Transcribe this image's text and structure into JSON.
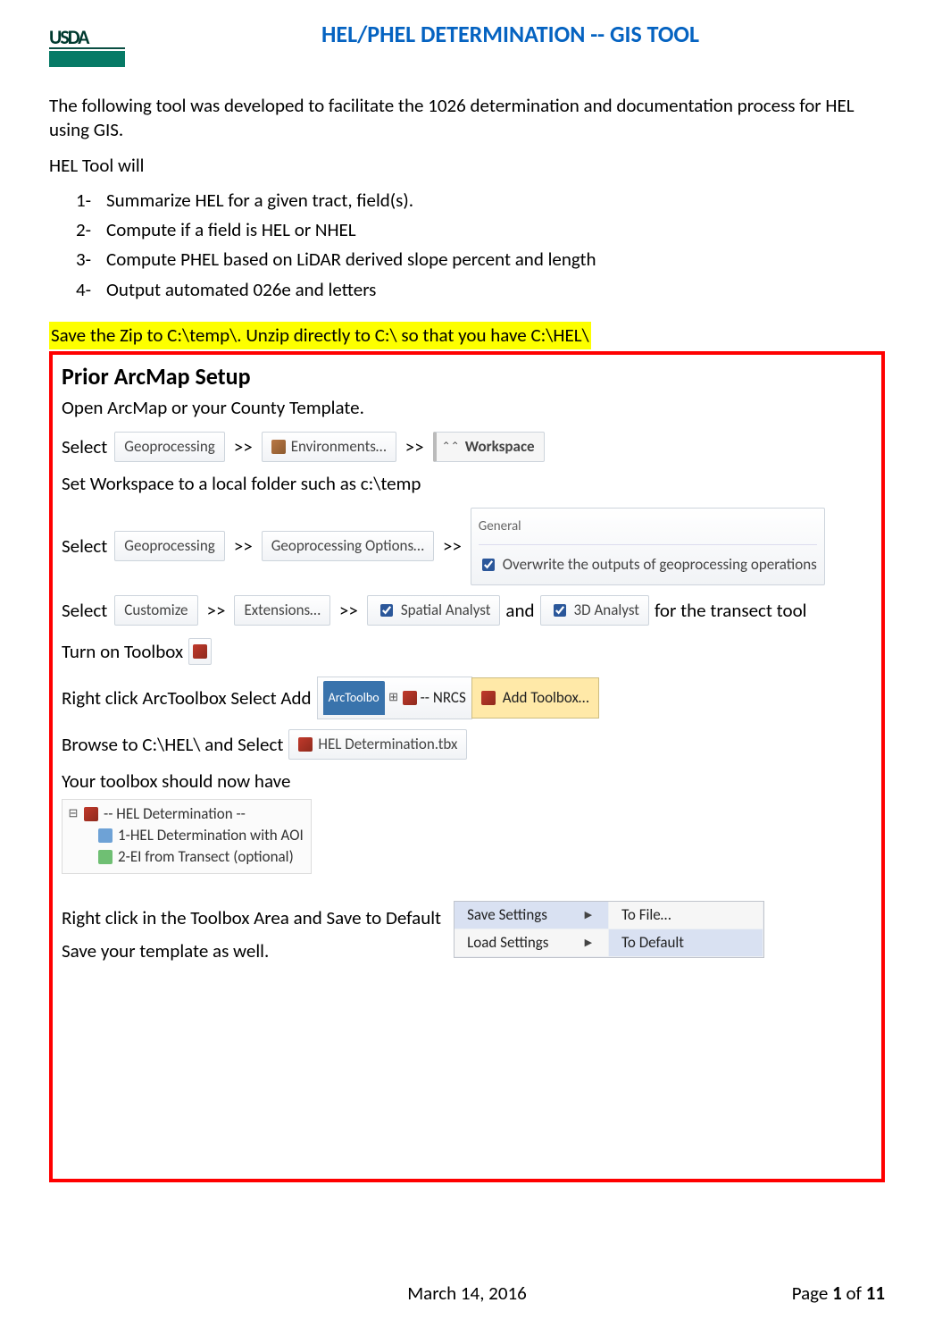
{
  "logo": {
    "text": "USDA"
  },
  "doc_title": "HEL/PHEL DETERMINATION -- GIS TOOL",
  "intro_text": "The following tool was developed to facilitate the 1026 determination and documentation process for HEL using GIS.",
  "heltool_prefix": "HEL Tool will",
  "list_items": [
    "Summarize HEL for a given tract, field(s).",
    "Compute if a field is HEL or NHEL",
    "Compute PHEL based on LiDAR derived slope percent and length",
    "Output automated 026e and letters"
  ],
  "highlight_line": "Save the Zip to C:\\temp\\. Unzip directly to C:\\ so that you have C:\\HEL\\",
  "section_title": "Prior ArcMap Setup",
  "open_arc": "Open ArcMap or your County Template.",
  "select_label": "Select",
  "and_label": "and",
  "for_transect_label": "for the transect tool",
  "sep": ">>",
  "geoprocessing_label": "Geoprocessing",
  "environments_label": "Environments…",
  "workspace_label": "Workspace",
  "set_workspace_line": "Set Workspace to a local folder such as c:\\temp",
  "geo_options_label": "Geoprocessing Options…",
  "general_label": "General",
  "overwrite_label": "Overwrite the outputs of geoprocessing operations",
  "customize_label": "Customize",
  "extensions_label": "Extensions…",
  "spatial_label": "Spatial Analyst",
  "analyst3d_label": "3D Analyst",
  "turn_on_toolbox": "Turn on Toolbox",
  "rightclick_arctoolbox": "Right click ArcToolbox Select Add",
  "arctoolbox_tab": "ArcToolbo",
  "arctoolbox_nrcs": "-- NRCS",
  "add_toolbox_label": "Add Toolbox…",
  "browse_line": "Browse to C:\\HEL\\ and Select",
  "heldet_tbx": "HEL Determination.tbx",
  "your_toolbox_line": "Your toolbox should now have",
  "tree": {
    "root": "-- HEL Determination --",
    "child1": "1-HEL Determination with AOI",
    "child2": "2-EI from Transect (optional)"
  },
  "rightclick_save": "Right click in the Toolbox Area and Save to Default",
  "save_template": "Save your template as well.",
  "menu": {
    "save_settings": "Save Settings",
    "load_settings": "Load Settings",
    "to_file": "To File…",
    "to_default": "To Default"
  },
  "footer": {
    "date": "March 14, 2016",
    "page_label": "Page",
    "page_num": "1",
    "of_label": "of",
    "total": "11"
  }
}
